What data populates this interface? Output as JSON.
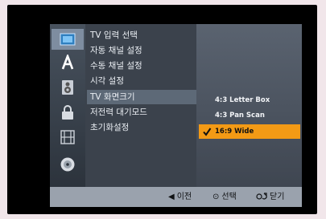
{
  "icons": [
    {
      "name": "disc-setup-icon",
      "active": true
    },
    {
      "name": "language-a-icon",
      "active": false
    },
    {
      "name": "speaker-audio-icon",
      "active": false
    },
    {
      "name": "lock-icon",
      "active": false
    },
    {
      "name": "film-strip-icon",
      "active": false
    },
    {
      "name": "disc-icon",
      "active": false
    }
  ],
  "menu": {
    "items": [
      {
        "label": "TV 입력 선택"
      },
      {
        "label": "자동 채널 설정"
      },
      {
        "label": "수동 채널 설정"
      },
      {
        "label": "시각 설정"
      },
      {
        "label": "TV 화면크기"
      },
      {
        "label": "저전력 대기모드"
      },
      {
        "label": "초기화설정"
      }
    ],
    "selected_index": 4
  },
  "submenu": {
    "items": [
      {
        "label": "4:3 Letter Box"
      },
      {
        "label": "4:3 Pan Scan"
      },
      {
        "label": "16:9 Wide"
      }
    ],
    "selected_index": 2
  },
  "footer": {
    "prev_symbol": "◀",
    "prev_label": "이전",
    "select_symbol": "⊙",
    "select_label": "선택",
    "close_label": "닫기"
  },
  "colors": {
    "highlight": "#f39a15",
    "frame": "#000000",
    "page_background": "#f1e6ea"
  }
}
